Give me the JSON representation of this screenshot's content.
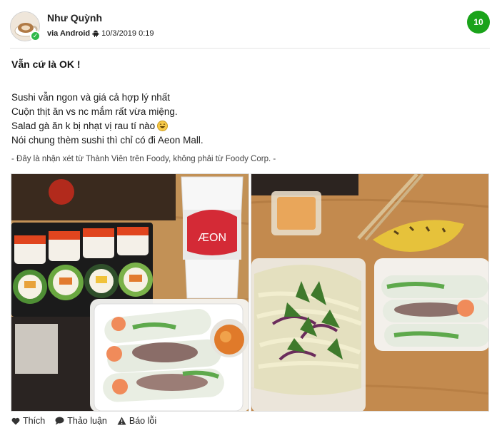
{
  "post": {
    "user_name": "Như Quỳnh",
    "via": "via Android",
    "date": "10/3/2019 0:19",
    "score": "10",
    "title": "Vẫn cứ là OK !",
    "lines": [
      "Sushi vẫn ngon và giá cả hợp lý nhất",
      "Cuộn thịt ăn vs nc mắm rất vừa miệng.",
      "Salad gà ăn k bị nhạt vị rau tí nào",
      "Nói chung thèm sushi thì chỉ có đi Aeon Mall."
    ],
    "disclaimer": "- Đây là nhận xét từ Thành Viên trên Foody, không phải từ Foody Corp. -"
  },
  "actions": {
    "like": "Thích",
    "discuss": "Thảo luận",
    "report": "Báo lỗi"
  },
  "photo_text": {
    "cup_brand": "ÆON"
  },
  "colors": {
    "score_badge": "#1aa31a",
    "verified_badge": "#2fb84a"
  },
  "icons": [
    "android-icon",
    "smile-emoji-icon",
    "heart-icon",
    "speech-bubble-icon",
    "warning-icon"
  ]
}
